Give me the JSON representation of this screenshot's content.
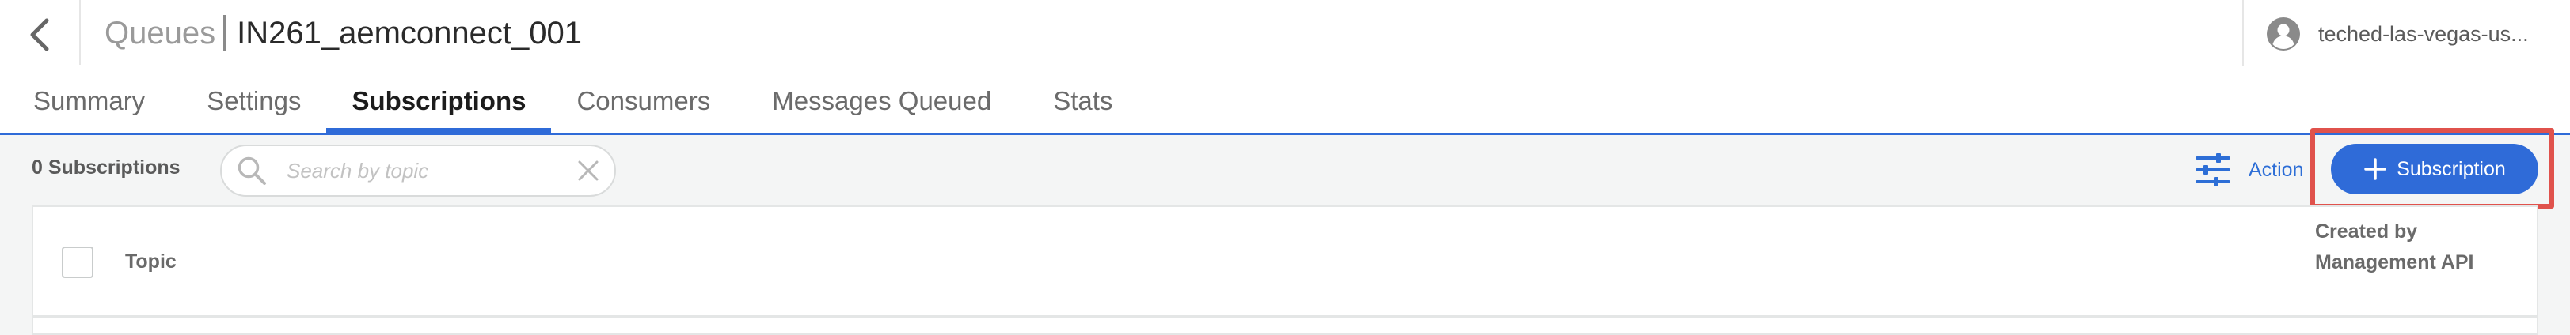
{
  "header": {
    "breadcrumb_parent": "Queues",
    "title": "IN261_aemconnect_001",
    "user_name": "teched-las-vegas-us..."
  },
  "tabs": [
    {
      "label": "Summary",
      "active": false
    },
    {
      "label": "Settings",
      "active": false
    },
    {
      "label": "Subscriptions",
      "active": true
    },
    {
      "label": "Consumers",
      "active": false
    },
    {
      "label": "Messages Queued",
      "active": false
    },
    {
      "label": "Stats",
      "active": false
    }
  ],
  "toolbar": {
    "count_label": "0 Subscriptions",
    "search_placeholder": "Search by topic",
    "search_value": "",
    "action_label": "Action",
    "add_button_label": "Subscription"
  },
  "table": {
    "columns": [
      {
        "label": "Topic"
      },
      {
        "label": "Created by Management API"
      }
    ],
    "rows": []
  },
  "colors": {
    "accent": "#2f6bd8",
    "highlight": "#e0524c",
    "toolbar_bg": "#f4f5f5"
  },
  "icons": {
    "back": "chevron-left-icon",
    "user": "user-circle-icon",
    "search": "search-icon",
    "clear": "close-icon",
    "action": "sliders-icon",
    "add": "plus-icon"
  }
}
